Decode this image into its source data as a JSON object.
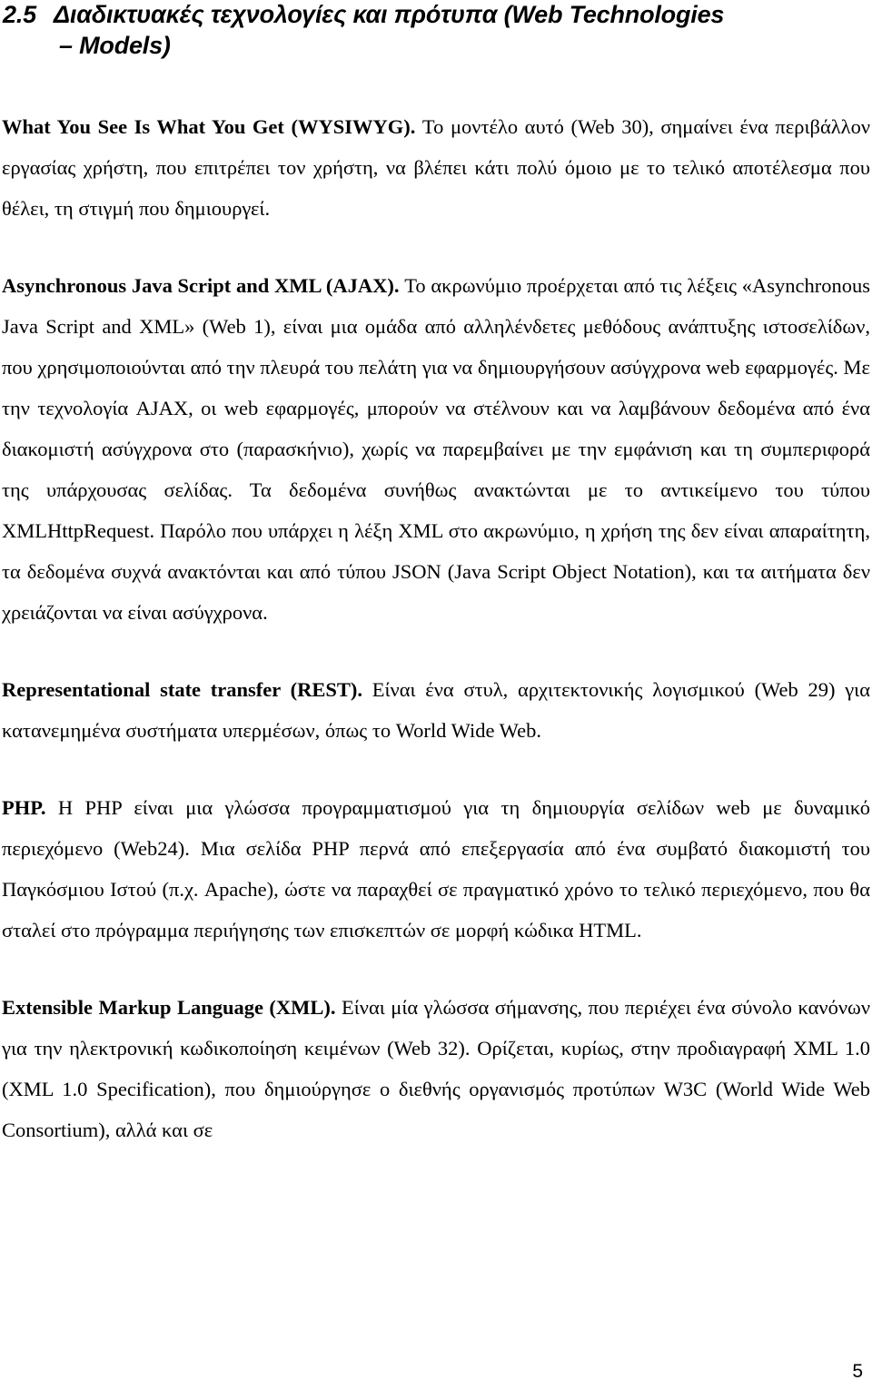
{
  "document": {
    "page_number": "5",
    "heading": {
      "number": "2.5",
      "line1": "Διαδικτυακές τεχνολογίες και πρότυπα (Web Technologies",
      "line2": "– Models)"
    },
    "paragraphs": [
      {
        "id": "wysiwyg",
        "lead": "What You See Is What You Get (WYSIWYG).",
        "text": " Το μοντέλο αυτό (Web 30), σημαίνει ένα περιβάλλον εργασίας χρήστη, που επιτρέπει τον χρήστη, να βλέπει κάτι πολύ όμοιο με το τελικό αποτέλεσμα που θέλει, τη στιγμή που δημιουργεί."
      },
      {
        "id": "ajax",
        "lead": "Asynchronous Java Script and XML (AJAX).",
        "text": " Το ακρωνύμιο προέρχεται από τις λέξεις «Asynchronous Java Script and XML» (Web 1), είναι μια ομάδα από αλληλένδετες μεθόδους ανάπτυξης ιστοσελίδων, που χρησιμοποιούνται από την πλευρά του πελάτη για να δημιουργήσουν ασύγχρονα web εφαρμογές. Με την τεχνολογία AJAX, οι web εφαρμογές, μπορούν να στέλνουν και να λαμβάνουν δεδομένα από ένα διακομιστή ασύγχρονα στο (παρασκήνιο), χωρίς να παρεμβαίνει με την εμφάνιση και τη συμπεριφορά της υπάρχουσας σελίδας. Τα δεδομένα συνήθως ανακτώνται με το αντικείμενο του τύπου XMLHttpRequest. Παρόλο που υπάρχει η λέξη XML στο ακρωνύμιο, η χρήση της δεν είναι απαραίτητη, τα δεδομένα συχνά ανακτόνται και από τύπου JSON (Java Script Object Notation), και τα αιτήματα δεν χρειάζονται να είναι ασύγχρονα."
      },
      {
        "id": "rest",
        "lead": "Representational state transfer (REST).",
        "text": " Είναι ένα στυλ, αρχιτεκτονικής λογισμικού (Web 29) για κατανεμημένα συστήματα υπερμέσων, όπως το World Wide Web."
      },
      {
        "id": "php",
        "lead": "PHP.",
        "text": " Η PHP είναι μια γλώσσα προγραμματισμού για τη δημιουργία σελίδων web με δυναμικό περιεχόμενο (Web24). Μια σελίδα PHP περνά από επεξεργασία από ένα συμβατό διακομιστή του Παγκόσμιου Ιστού (π.χ. Apache), ώστε να παραχθεί σε πραγματικό χρόνο το τελικό περιεχόμενο, που θα σταλεί στο πρόγραμμα περιήγησης των επισκεπτών σε μορφή κώδικα HTML."
      },
      {
        "id": "xml",
        "lead": "Extensible Markup Language (XML).",
        "text": " Είναι μία γλώσσα σήμανσης, που περιέχει ένα σύνολο κανόνων για την ηλεκτρονική κωδικοποίηση κειμένων (Web 32). Ορίζεται, κυρίως, στην προδιαγραφή XML 1.0 (XML 1.0 Specification), που δημιούργησε ο διεθνής οργανισμός προτύπων W3C (World Wide Web Consortium), αλλά και σε"
      }
    ]
  }
}
